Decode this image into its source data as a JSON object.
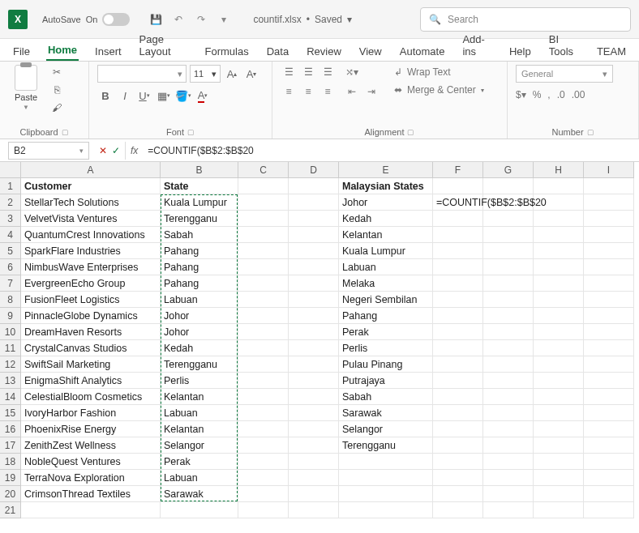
{
  "titlebar": {
    "autosave_label": "AutoSave",
    "autosave_state": "On",
    "doc_name": "countif.xlsx",
    "save_state": "Saved",
    "search_placeholder": "Search"
  },
  "tabs": [
    "File",
    "Home",
    "Insert",
    "Page Layout",
    "Formulas",
    "Data",
    "Review",
    "View",
    "Automate",
    "Add-ins",
    "Help",
    "BI Tools",
    "TEAM"
  ],
  "active_tab": "Home",
  "ribbon": {
    "clipboard_label": "Clipboard",
    "paste_label": "Paste",
    "font_label": "Font",
    "font_size": "11",
    "alignment_label": "Alignment",
    "wrap_label": "Wrap Text",
    "merge_label": "Merge & Center",
    "number_label": "Number",
    "number_format": "General"
  },
  "formula_bar": {
    "name_box": "B2",
    "formula": "=COUNTIF($B$2:$B$20"
  },
  "columns": [
    "A",
    "B",
    "C",
    "D",
    "E",
    "F",
    "G",
    "H",
    "I"
  ],
  "col_widths": {
    "A": 172,
    "B": 96,
    "C": 62,
    "D": 62,
    "E": 116,
    "F": 62,
    "G": 62,
    "H": 62,
    "I": 62
  },
  "headers": {
    "A": "Customer",
    "B": "State",
    "E": "Malaysian States"
  },
  "customers": [
    {
      "name": "StellarTech Solutions",
      "state": "Kuala Lumpur"
    },
    {
      "name": "VelvetVista Ventures",
      "state": "Terengganu"
    },
    {
      "name": "QuantumCrest Innovations",
      "state": "Sabah"
    },
    {
      "name": "SparkFlare Industries",
      "state": "Pahang"
    },
    {
      "name": "NimbusWave Enterprises",
      "state": "Pahang"
    },
    {
      "name": "EvergreenEcho Group",
      "state": "Pahang"
    },
    {
      "name": "FusionFleet Logistics",
      "state": "Labuan"
    },
    {
      "name": "PinnacleGlobe Dynamics",
      "state": "Johor"
    },
    {
      "name": "DreamHaven Resorts",
      "state": "Johor"
    },
    {
      "name": "CrystalCanvas Studios",
      "state": "Kedah"
    },
    {
      "name": "SwiftSail Marketing",
      "state": "Terengganu"
    },
    {
      "name": "EnigmaShift Analytics",
      "state": "Perlis"
    },
    {
      "name": "CelestialBloom Cosmetics",
      "state": "Kelantan"
    },
    {
      "name": "IvoryHarbor Fashion",
      "state": "Labuan"
    },
    {
      "name": "PhoenixRise Energy",
      "state": "Kelantan"
    },
    {
      "name": "ZenithZest Wellness",
      "state": "Selangor"
    },
    {
      "name": "NobleQuest Ventures",
      "state": "Perak"
    },
    {
      "name": "TerraNova Exploration",
      "state": "Labuan"
    },
    {
      "name": "CrimsonThread Textiles",
      "state": "Sarawak"
    }
  ],
  "malaysian_states": [
    "Johor",
    "Kedah",
    "Kelantan",
    "Kuala Lumpur",
    "Labuan",
    "Melaka",
    "Negeri Sembilan",
    "Pahang",
    "Perak",
    "Perlis",
    "Pulau Pinang",
    "Putrajaya",
    "Sabah",
    "Sarawak",
    "Selangor",
    "Terengganu"
  ],
  "f2_text": "=COUNTIF($B$2:$B$20",
  "total_rows": 21
}
